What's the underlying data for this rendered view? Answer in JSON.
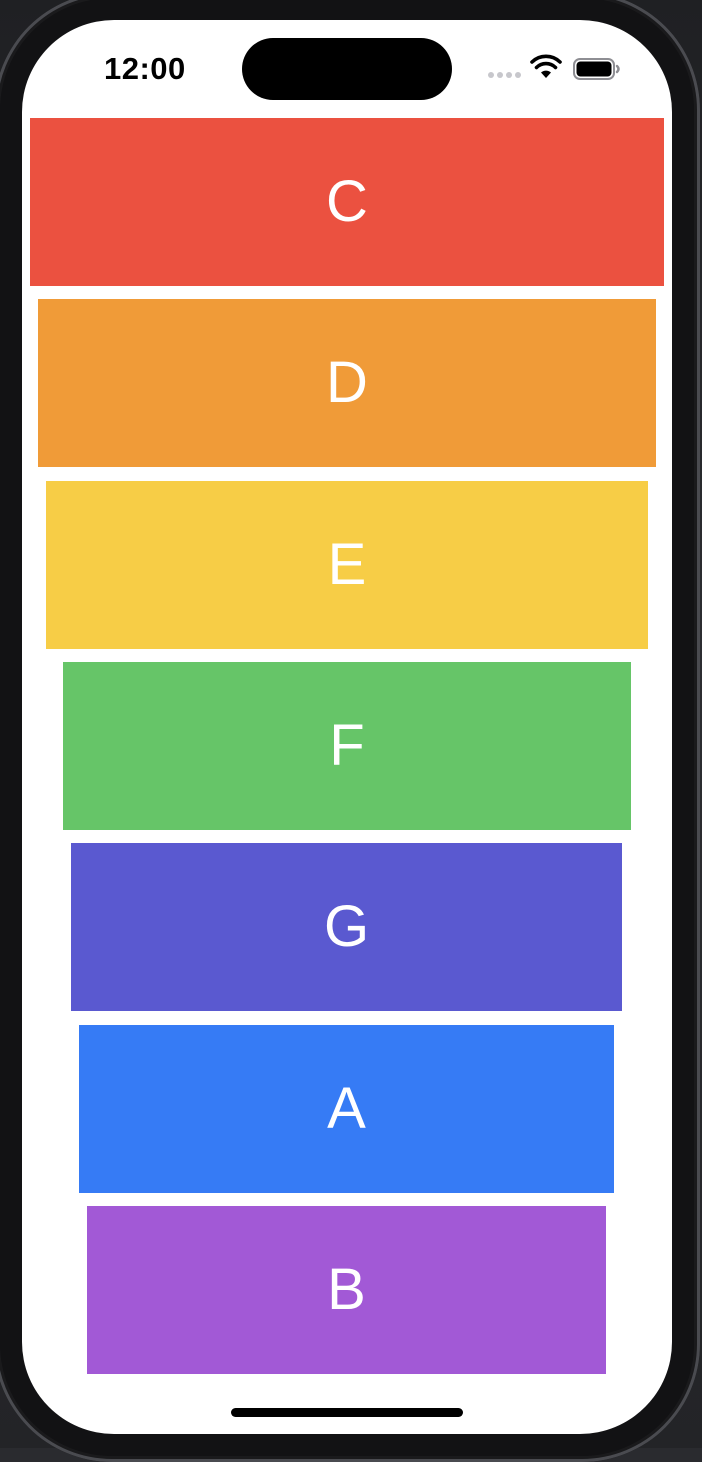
{
  "status_bar": {
    "time": "12:00",
    "icons": [
      "cellular-signal-icon",
      "wifi-icon",
      "battery-icon"
    ]
  },
  "cards": [
    {
      "label": "C",
      "color": "#EB5140"
    },
    {
      "label": "D",
      "color": "#F09B38"
    },
    {
      "label": "E",
      "color": "#F7CD46"
    },
    {
      "label": "F",
      "color": "#66C568"
    },
    {
      "label": "G",
      "color": "#5A59D0"
    },
    {
      "label": "A",
      "color": "#367BF5"
    },
    {
      "label": "B",
      "color": "#A259D6"
    }
  ]
}
